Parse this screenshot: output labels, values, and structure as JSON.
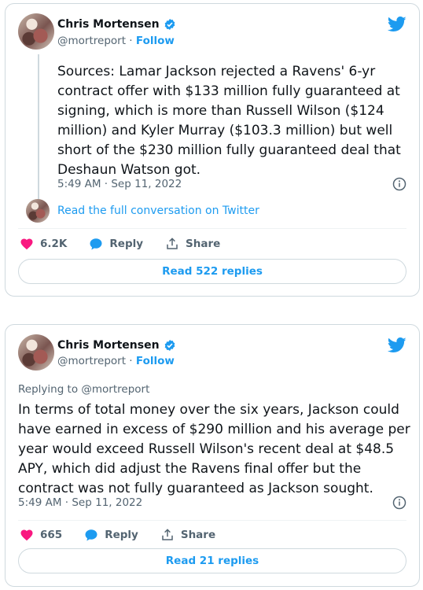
{
  "tweets": [
    {
      "author": {
        "name": "Chris Mortensen",
        "handle": "@mortreport",
        "separator": "·",
        "follow": "Follow"
      },
      "text": "Sources: Lamar Jackson rejected a Ravens'  6-yr contract offer with $133 million fully guaranteed at signing, which is more than Russell Wilson ($124 million) and Kyler Murray ($103.3 million) but well short of the $230 million fully guaranteed deal that Deshaun Watson got.",
      "timestamp": "5:49 AM · Sep 11, 2022",
      "conversation_link": "Read the full conversation on Twitter",
      "likes": "6.2K",
      "reply_label": "Reply",
      "share_label": "Share",
      "read_replies": "Read 522 replies"
    },
    {
      "author": {
        "name": "Chris Mortensen",
        "handle": "@mortreport",
        "separator": "·",
        "follow": "Follow"
      },
      "replying_to": "Replying to @mortreport",
      "text": "In terms of total money over the six years, Jackson could have earned in excess of $290 million and his average per year would exceed Russell Wilson's recent deal at  $48.5 APY, which did adjust the Ravens final offer but the contract was not fully guaranteed as Jackson sought.",
      "timestamp": "5:49 AM · Sep 11, 2022",
      "likes": "665",
      "reply_label": "Reply",
      "share_label": "Share",
      "read_replies": "Read 21 replies"
    }
  ],
  "colors": {
    "accent": "#1d9bf0",
    "like": "#f91880",
    "muted": "#536471",
    "border": "#cfd9de"
  },
  "icons": [
    "twitter-bird-icon",
    "verified-badge-icon",
    "heart-icon",
    "reply-bubble-icon",
    "share-icon",
    "info-icon"
  ]
}
